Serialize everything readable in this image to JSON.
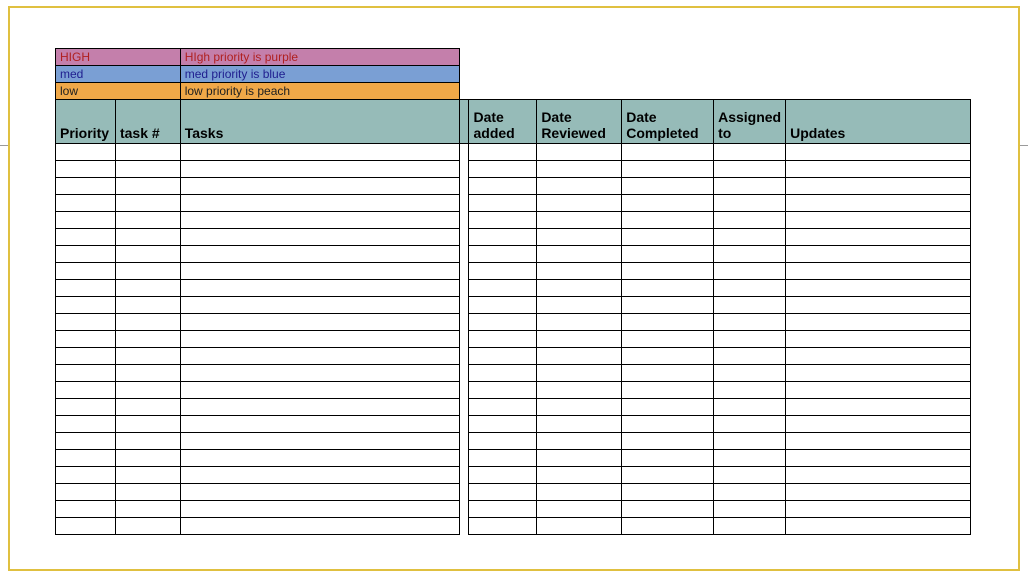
{
  "legend": {
    "high": {
      "label": "HIGH",
      "desc": "HIgh priority is purple"
    },
    "med": {
      "label": "med",
      "desc": "med priority is blue"
    },
    "low": {
      "label": "low",
      "desc": "low priority is peach"
    }
  },
  "headers": {
    "priority": "Priority",
    "tasknum": "task #",
    "tasks": "Tasks",
    "dateadded": "Date added",
    "datereviewed": "Date Reviewed",
    "datecompleted": "Date Completed",
    "assigned": "Assigned to",
    "updates": "Updates"
  },
  "rowCount": 23
}
